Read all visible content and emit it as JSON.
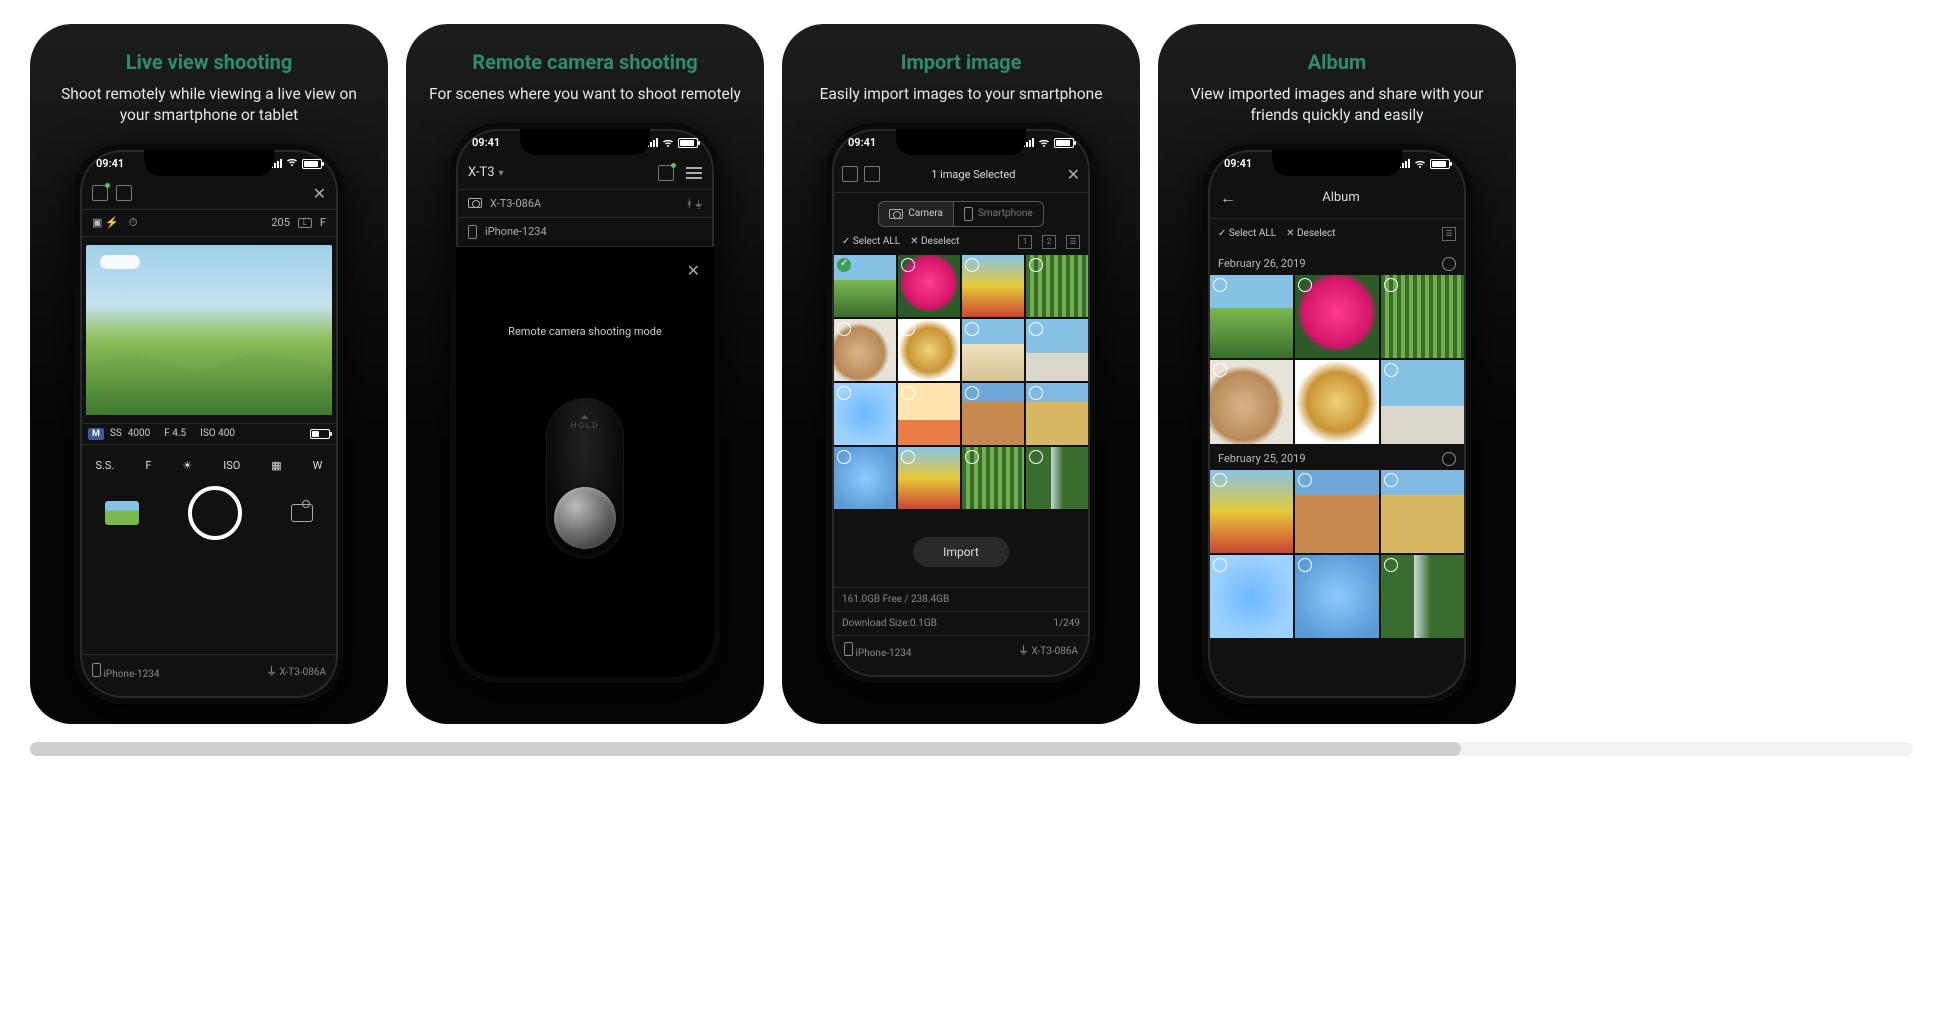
{
  "colors": {
    "accent": "#2e8b6e"
  },
  "status": {
    "time": "09:41"
  },
  "panels": [
    {
      "title": "Live view shooting",
      "subtitle": "Shoot remotely while viewing a live view on your smartphone or tablet",
      "screen": {
        "shots_remaining": "205",
        "row2_labels": {
          "l": "L",
          "f": "F"
        },
        "info": {
          "mode": "M",
          "ss": "4000",
          "ss_prefix": "SS",
          "f": "F 4.5",
          "iso": "ISO 400"
        },
        "ctrls": [
          "S.S.",
          "F",
          "☀",
          "ISO",
          "▦",
          "W"
        ],
        "footer": {
          "phone": "iPhone-1234",
          "camera": "X-T3-086A"
        }
      }
    },
    {
      "title": "Remote camera shooting",
      "subtitle": "For scenes where you want to shoot remotely",
      "screen": {
        "camera_name": "X-T3",
        "lines": [
          {
            "icon": "camera",
            "text": "X-T3-086A"
          },
          {
            "icon": "phone",
            "text": "iPhone-1234"
          }
        ],
        "message": "Remote camera shooting mode",
        "hold": "HOLD"
      }
    },
    {
      "title": "Import image",
      "subtitle": "Easily import images to your smartphone",
      "screen": {
        "header": "1 image Selected",
        "tabs": {
          "camera": "Camera",
          "smartphone": "Smartphone"
        },
        "sel": {
          "all": "Select ALL",
          "none": "Deselect"
        },
        "slots": [
          "1",
          "2"
        ],
        "import_btn": "Import",
        "storage": "161.0GB Free / 238.4GB",
        "download": "Download Size:0.1GB",
        "page": "1/249",
        "footer": {
          "phone": "iPhone-1234",
          "camera": "X-T3-086A"
        }
      }
    },
    {
      "title": "Album",
      "subtitle": "View imported images and share with your friends quickly and easily",
      "screen": {
        "title": "Album",
        "sel": {
          "all": "Select ALL",
          "none": "Deselect"
        },
        "dates": [
          "February 26, 2019",
          "February 25, 2019"
        ]
      }
    }
  ]
}
